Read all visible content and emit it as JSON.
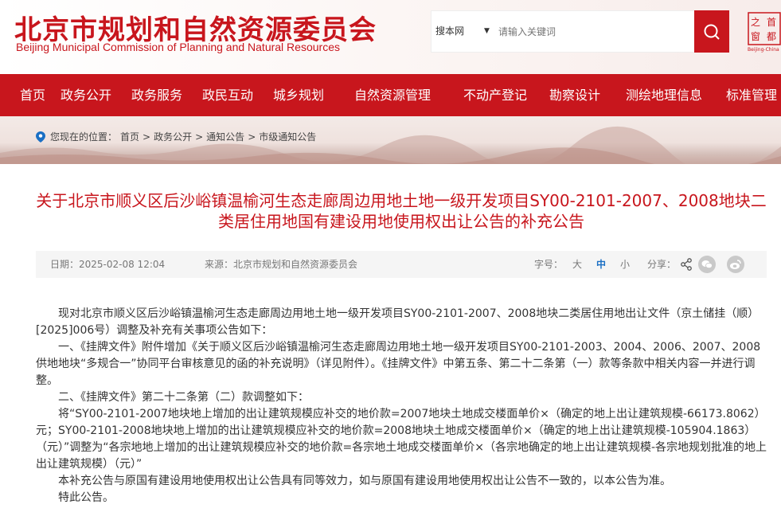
{
  "site": {
    "title": "北京市规划和自然资源委员会",
    "subtitle": "Beijing Municipal Commission of Planning and Natural Resources"
  },
  "search": {
    "scope": "搜本网",
    "placeholder": "请输入关键词"
  },
  "logo": {
    "chars": [
      "首",
      "都",
      "之",
      "窗"
    ],
    "caption": "Beijing-China"
  },
  "nav": {
    "items": [
      "首页",
      "政务公开",
      "政务服务",
      "政民互动",
      "城乡规划",
      "自然资源管理",
      "不动产登记",
      "勘察设计",
      "测绘地理信息",
      "标准管理"
    ]
  },
  "breadcrumb": {
    "prefix": "您现在的位置：",
    "items": [
      "首页",
      "政务公开",
      "通知公告",
      "市级通知公告"
    ],
    "separator": ">"
  },
  "article": {
    "title": "关于北京市顺义区后沙峪镇温榆河生态走廊周边用地土地一级开发项目SY00-2101-2007、2008地块二类居住用地国有建设用地使用权出让公告的补充公告",
    "date": "日期：2025-02-08 12:04",
    "source": "来源：北京市规划和自然资源委员会",
    "font_label": "字号：",
    "font_large": "大",
    "font_medium": "中",
    "font_small": "小",
    "share_label": "分享：",
    "paragraphs": [
      "现对北京市顺义区后沙峪镇温榆河生态走廊周边用地土地一级开发项目SY00-2101-2007、2008地块二类居住用地出让文件（京土储挂（顺）[2025]006号）调整及补充有关事项公告如下：",
      "一、《挂牌文件》附件增加《关于顺义区后沙峪镇温榆河生态走廊周边用地土地一级开发项目SY00-2101-2003、2004、2006、2007、2008供地地块“多规合一”协同平台审核意见的函的补充说明》（详见附件）。《挂牌文件》中第五条、第二十二条第（一）款等条款中相关内容一并进行调整。",
      "二、《挂牌文件》第二十二条第（二）款调整如下：",
      "将“SY00-2101-2007地块地上增加的出让建筑规模应补交的地价款=2007地块土地成交楼面单价×（确定的地上出让建筑规模-66173.8062）元；SY00-2101-2008地块地上增加的出让建筑规模应补交的地价款=2008地块土地成交楼面单价×（确定的地上出让建筑规模-105904.1863）（元）”调整为“各宗地地上增加的出让建筑规模应补交的地价款=各宗地土地成交楼面单价×（各宗地确定的地上出让建筑规模-各宗地规划批准的地上出让建筑规模）（元）”",
      "本补充公告与原国有建设用地使用权出让公告具有同等效力，如与原国有建设用地使用权出让公告不一致的，以本公告为准。",
      "特此公告。"
    ]
  },
  "colors": {
    "brand": "#c8161d",
    "active_font": "#1a6fc4"
  }
}
